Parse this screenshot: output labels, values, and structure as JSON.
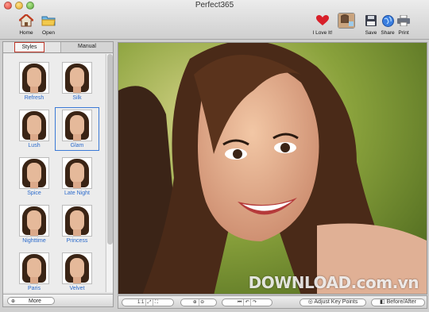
{
  "window": {
    "title": "Perfect365"
  },
  "toolbar": {
    "home": {
      "label": "Home",
      "icon": "house-icon"
    },
    "open": {
      "label": "Open",
      "icon": "folder-icon"
    },
    "love": {
      "label": "I Love It!",
      "icon": "heart-icon"
    },
    "save": {
      "label": "Save",
      "icon": "floppy-disk-icon"
    },
    "share": {
      "label": "Share",
      "icon": "globe-icon"
    },
    "print": {
      "label": "Print",
      "icon": "printer-icon"
    }
  },
  "panel": {
    "tabs": [
      {
        "label": "Styles",
        "active": true
      },
      {
        "label": "Manual",
        "active": false
      }
    ],
    "styles": [
      {
        "label": "Refresh",
        "selected": false
      },
      {
        "label": "Silk",
        "selected": false
      },
      {
        "label": "Lush",
        "selected": false
      },
      {
        "label": "Glam",
        "selected": true
      },
      {
        "label": "Spice",
        "selected": false
      },
      {
        "label": "Late Night",
        "selected": false
      },
      {
        "label": "Nighttime",
        "selected": false
      },
      {
        "label": "Princess",
        "selected": false
      },
      {
        "label": "Paris",
        "selected": false
      },
      {
        "label": "Velvet",
        "selected": false
      }
    ],
    "more_label": "More"
  },
  "bottombar": {
    "zoom_actual": "1:1",
    "adjust_key_points": "Adjust Key Points",
    "before_after": "Before/After"
  },
  "watermark": "DOWNLOAD.com.vn",
  "colors": {
    "accent": "#3b7ad6",
    "active_tab_border": "#c0392b",
    "style_label": "#2b6acb"
  }
}
